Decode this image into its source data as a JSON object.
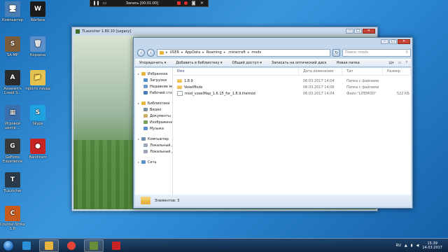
{
  "recorder": {
    "time_label": "Запись [00:01:00]"
  },
  "desktop_icons": [
    {
      "label": "Компьютер",
      "color": "#4a7fb5",
      "glyph": "🖥"
    },
    {
      "label": "Warface",
      "color": "#1b1b1b",
      "glyph": "W"
    },
    {
      "label": "SA-MP",
      "color": "#7a5c3a",
      "glyph": "S"
    },
    {
      "label": "Корзина",
      "color": "#5b8fc9",
      "glyph": "🗑"
    },
    {
      "label": "Assassin's Creed S...",
      "color": "#2b2b2b",
      "glyph": "A"
    },
    {
      "label": "просто пизда",
      "color": "#e5c24f",
      "glyph": "📁"
    },
    {
      "label": "Игровой центр ...",
      "color": "#3a6fae",
      "glyph": "▦"
    },
    {
      "label": "Skype",
      "color": "#1ea3e0",
      "glyph": "S"
    },
    {
      "label": "GeForce Experience",
      "color": "#3a3a3a",
      "glyph": "G"
    },
    {
      "label": "Bandicam",
      "color": "#c82424",
      "glyph": "●"
    },
    {
      "label": "TLauncher",
      "color": "#2b3a4a",
      "glyph": "T"
    },
    {
      "label": "Counter-Strike 1.6",
      "color": "#c85a1e",
      "glyph": "C"
    }
  ],
  "tlauncher": {
    "title": "TLauncher 1.80.10 [Legacy]",
    "buttons": {
      "minimize": "–",
      "maximize": "□",
      "close": "✕"
    }
  },
  "explorer": {
    "path": [
      "USER",
      "AppData",
      "Roaming",
      ".minecraft",
      "mods"
    ],
    "search_placeholder": "Поиск: mods",
    "toolbar": [
      "Упорядочить ▾",
      "Добавить в библиотеку ▾",
      "Общий доступ ▾",
      "Записать на оптический диск",
      "Новая папка"
    ],
    "nav": [
      {
        "label": "Избранное",
        "type": "sect",
        "color": "#e6b53d"
      },
      {
        "label": "Загрузки",
        "type": "item",
        "color": "#5b8fc9"
      },
      {
        "label": "Недавние места",
        "type": "item",
        "color": "#6f9bd0"
      },
      {
        "label": "Рабочий стол",
        "type": "item",
        "color": "#4a7fb5"
      },
      {
        "label": "",
        "type": "gap",
        "color": ""
      },
      {
        "label": "Библиотеки",
        "type": "sect",
        "color": "#e6b53d"
      },
      {
        "label": "Видео",
        "type": "item",
        "color": "#7a8fa6"
      },
      {
        "label": "Документы",
        "type": "item",
        "color": "#c9b068"
      },
      {
        "label": "Изображения",
        "type": "item",
        "color": "#78a05b"
      },
      {
        "label": "Музыка",
        "type": "item",
        "color": "#5b8fc9"
      },
      {
        "label": "",
        "type": "gap",
        "color": ""
      },
      {
        "label": "Компьютер",
        "type": "sect",
        "color": "#6f8fb0"
      },
      {
        "label": "Локальный диск (C:)",
        "type": "item",
        "color": "#9aa7b5"
      },
      {
        "label": "Локальный диск (D:)",
        "type": "item",
        "color": "#9aa7b5"
      },
      {
        "label": "",
        "type": "gap",
        "color": ""
      },
      {
        "label": "Сеть",
        "type": "sect",
        "color": "#5b8fc9"
      }
    ],
    "columns": {
      "name": "Имя",
      "date": "Дата изменения",
      "type": "Тип",
      "size": "Размер"
    },
    "files": [
      {
        "name": "1.8.9",
        "date": "06.03.2017 14:04",
        "type": "Папка с файлами",
        "size": "",
        "kind": "folder"
      },
      {
        "name": "VoxelMods",
        "date": "06.03.2017 14:06",
        "type": "Папка с файлами",
        "size": "",
        "kind": "folder"
      },
      {
        "name": "mod_voxelMap_1.6.15_for_1.8.9.litemod",
        "date": "06.03.2017 14:04",
        "type": "Файл \"LITEMOD\"",
        "size": "522 КБ",
        "kind": "file"
      }
    ],
    "status": "Элементов: 3",
    "buttons": {
      "minimize": "–",
      "maximize": "□",
      "close": "✕"
    }
  },
  "taskbar": {
    "apps": [
      {
        "name": "ie",
        "color": "#2a8fd6"
      },
      {
        "name": "explorer",
        "color": "#e6b53d"
      },
      {
        "name": "chrome",
        "color": "#e2443a"
      },
      {
        "name": "minecraft",
        "color": "#6a8f3a"
      },
      {
        "name": "bandicam",
        "color": "#c82424"
      }
    ],
    "language": "RU",
    "time": "15:39",
    "date": "14.03.2017"
  }
}
